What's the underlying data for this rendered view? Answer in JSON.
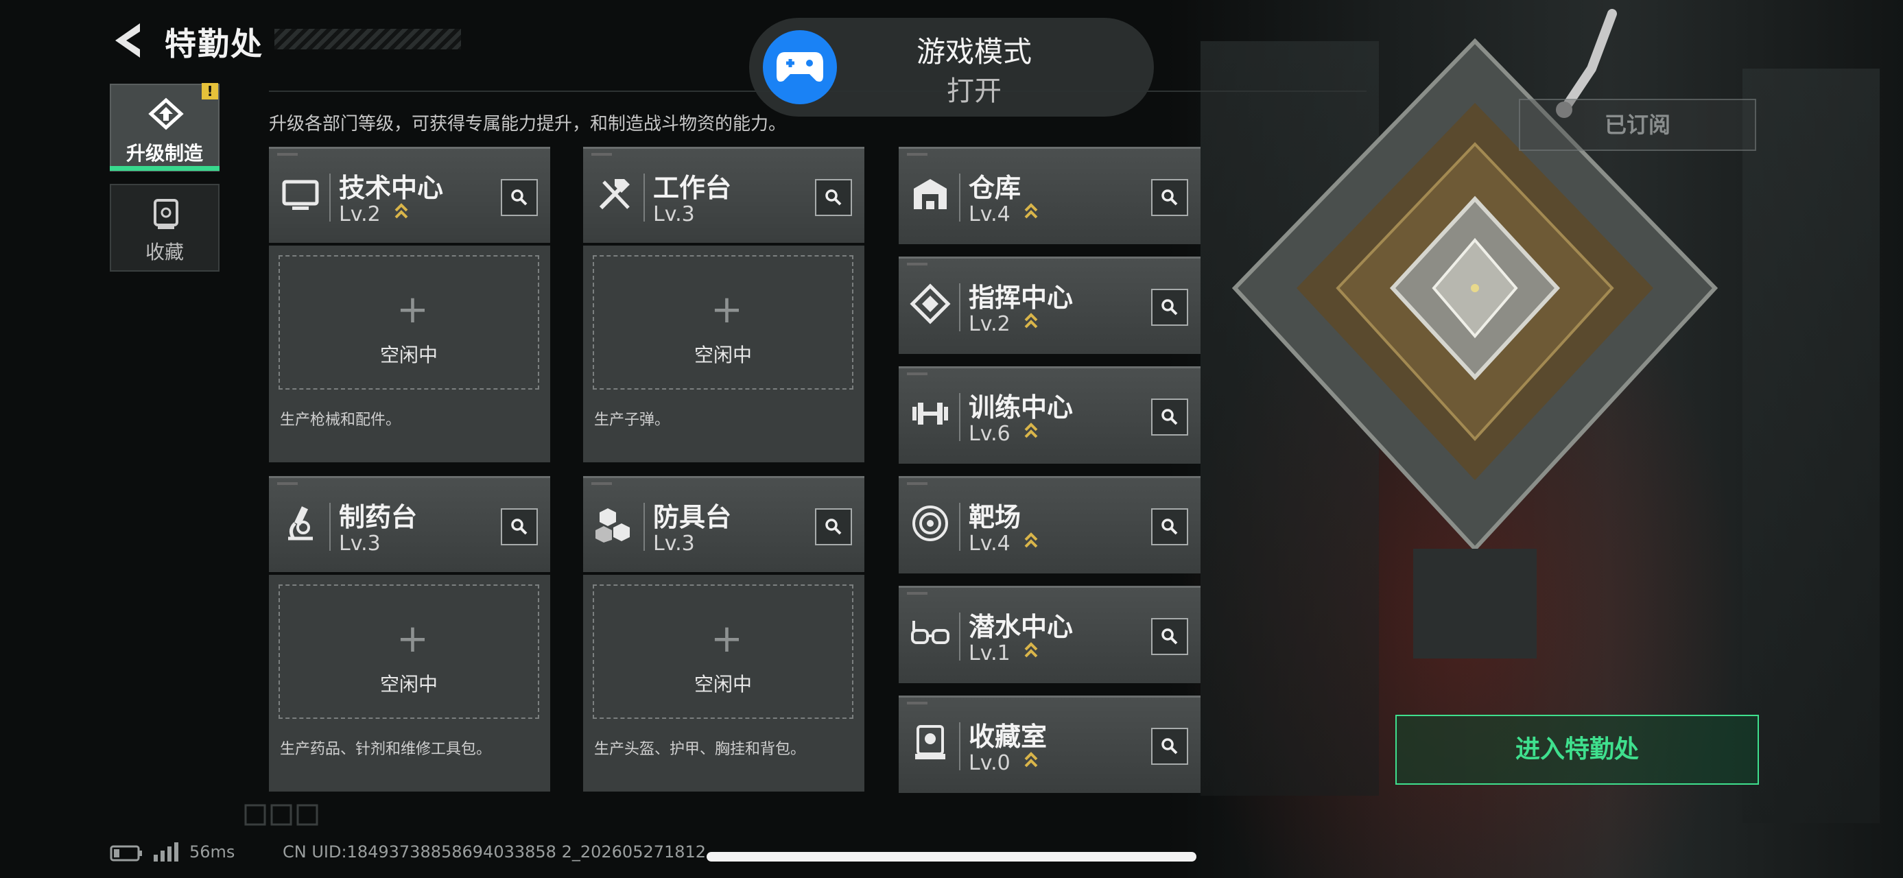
{
  "header": {
    "title": "特勤处"
  },
  "description": "升级各部门等级，可获得专属能力提升，和制造战斗物资的能力。",
  "tabs": [
    {
      "label": "升级制造",
      "active": true,
      "badge": "!"
    },
    {
      "label": "收藏",
      "active": false
    }
  ],
  "colors": {
    "accent": "#38d98e",
    "warning": "#e6c23a",
    "gamemode_icon": "#1a82f5"
  },
  "production_facilities": [
    {
      "name": "技术中心",
      "level": "Lv.2",
      "upgradeable": true,
      "slot_status": "空闲中",
      "slot_add": "+",
      "description": "生产枪械和配件。",
      "icon": "monitor-icon"
    },
    {
      "name": "工作台",
      "level": "Lv.3",
      "upgradeable": false,
      "slot_status": "空闲中",
      "slot_add": "+",
      "description": "生产子弹。",
      "icon": "tools-icon"
    },
    {
      "name": "制药台",
      "level": "Lv.3",
      "upgradeable": false,
      "slot_status": "空闲中",
      "slot_add": "+",
      "description": "生产药品、针剂和维修工具包。",
      "icon": "microscope-icon"
    },
    {
      "name": "防具台",
      "level": "Lv.3",
      "upgradeable": false,
      "slot_status": "空闲中",
      "slot_add": "+",
      "description": "生产头盔、护甲、胸挂和背包。",
      "icon": "cubes-icon"
    }
  ],
  "departments": [
    {
      "name": "仓库",
      "level": "Lv.4",
      "upgradeable": true,
      "icon": "warehouse-icon"
    },
    {
      "name": "指挥中心",
      "level": "Lv.2",
      "upgradeable": true,
      "icon": "command-icon"
    },
    {
      "name": "训练中心",
      "level": "Lv.6",
      "upgradeable": true,
      "icon": "dumbbell-icon"
    },
    {
      "name": "靶场",
      "level": "Lv.4",
      "upgradeable": true,
      "icon": "target-icon"
    },
    {
      "name": "潜水中心",
      "level": "Lv.1",
      "upgradeable": true,
      "icon": "goggles-icon"
    },
    {
      "name": "收藏室",
      "level": "Lv.0",
      "upgradeable": true,
      "icon": "collection-icon"
    }
  ],
  "game_mode": {
    "title": "游戏模式",
    "status": "打开"
  },
  "subscribed_label": "已订阅",
  "enter_button": "进入特勤处",
  "status_bar": {
    "ping": "56ms",
    "uid": "CN UID:18493738858694033858 2_202605271812"
  }
}
